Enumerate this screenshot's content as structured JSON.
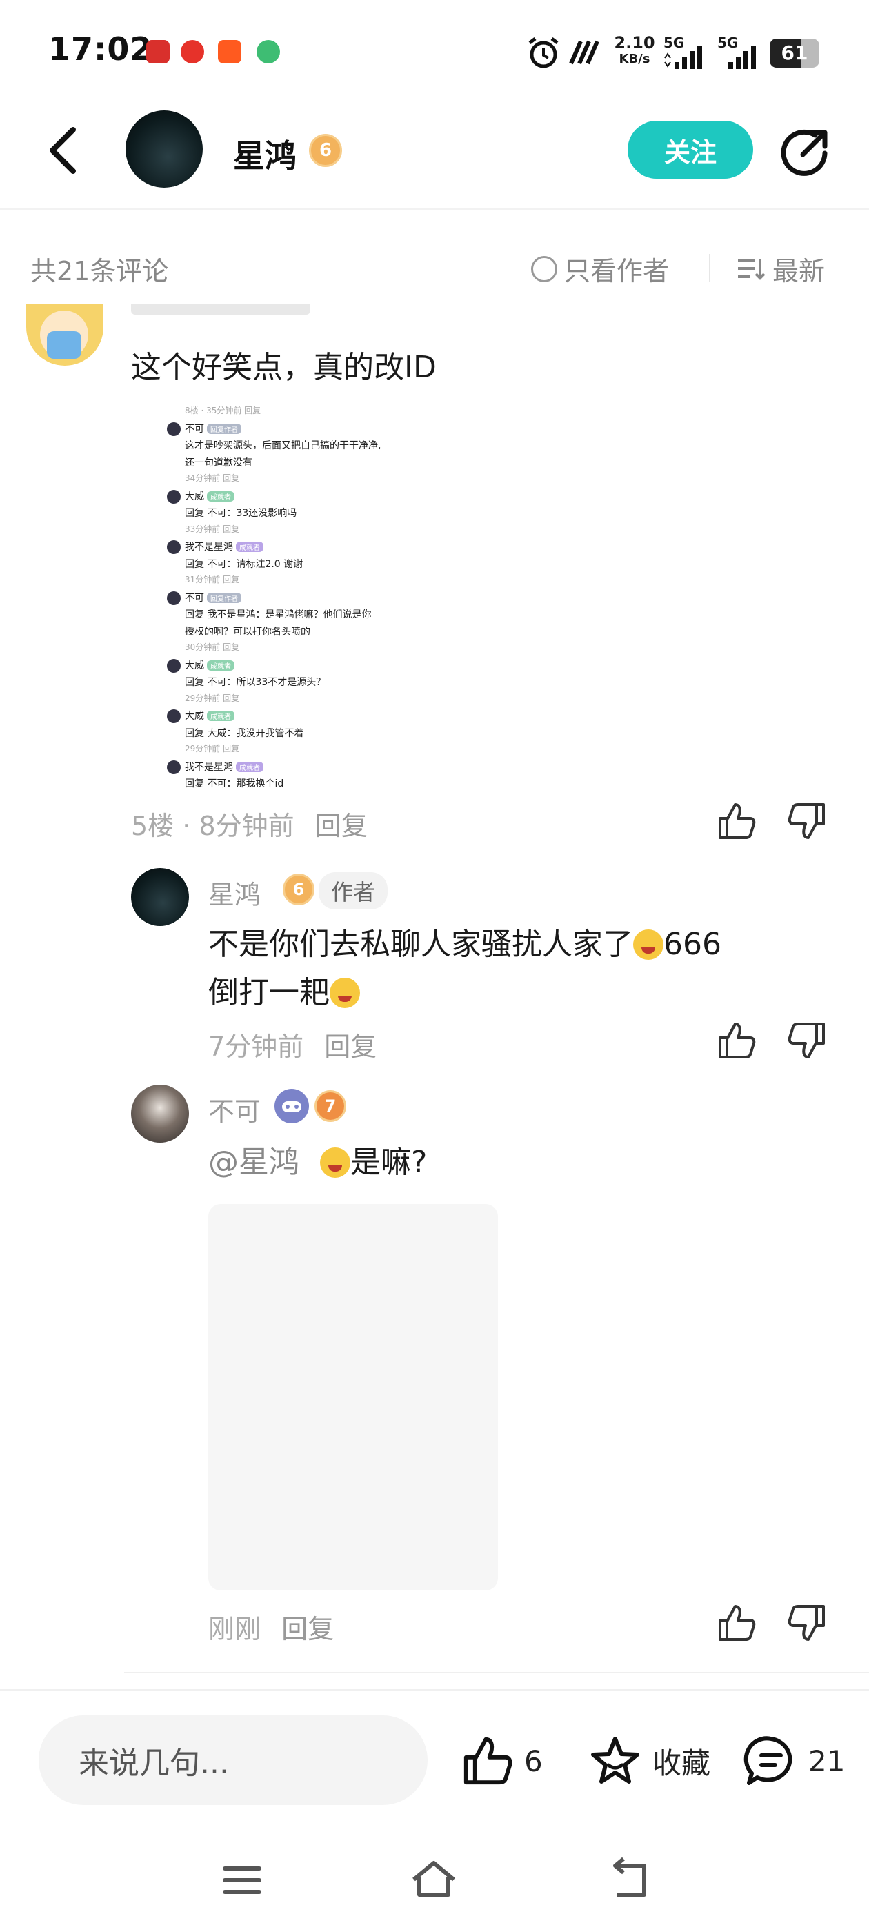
{
  "status": {
    "time": "17:02",
    "net_speed_value": "2.10",
    "net_speed_unit": "KB/s",
    "sim1": "5G",
    "sim2": "5G",
    "battery": "61"
  },
  "header": {
    "user_name": "星鸿",
    "level": "6",
    "follow_label": "关注"
  },
  "sort_bar": {
    "count_label": "共21条评论",
    "only_author_label": "只看作者",
    "newest_label": "最新"
  },
  "comments": [
    {
      "text": "这个好笑点，真的改ID",
      "floor": "5楼",
      "time": "8分钟前",
      "reply_label": "回复",
      "image": {
        "rows": [
          {
            "t": "8楼 · 35分钟前  回复",
            "g": true
          },
          {
            "t": "不可",
            "tag": "回复作者"
          },
          {
            "t": "这才是吵架源头，后面又把自己搞的干干净净,"
          },
          {
            "t": "还一句道歉没有"
          },
          {
            "t": "34分钟前  回复",
            "g": true
          },
          {
            "t": "大威",
            "tag": "成就者"
          },
          {
            "t": "回复 不可：33还没影响吗"
          },
          {
            "t": "33分钟前  回复",
            "g": true
          },
          {
            "t": "我不是星鸿",
            "tag": "成就者"
          },
          {
            "t": "回复 不可：请标注2.0 谢谢"
          },
          {
            "t": "31分钟前  回复",
            "g": true
          },
          {
            "t": "不可",
            "tag": "回复作者"
          },
          {
            "t": "回复 我不是星鸿：是星鸿佬嘛？他们说是你"
          },
          {
            "t": "授权的啊？可以打你名头喷的"
          },
          {
            "t": "30分钟前  回复",
            "g": true
          },
          {
            "t": "大威",
            "tag": "成就者"
          },
          {
            "t": "回复 不可：所以33不才是源头？"
          },
          {
            "t": "29分钟前  回复",
            "g": true
          },
          {
            "t": "大威",
            "tag": "成就者"
          },
          {
            "t": "回复 大威：我没开我管不着"
          },
          {
            "t": "29分钟前  回复",
            "g": true
          },
          {
            "t": "我不是星鸿",
            "tag": "成就者"
          },
          {
            "t": "回复 不可：那我换个id"
          }
        ]
      }
    },
    {
      "user_name": "星鸿",
      "level": "6",
      "author_tag": "作者",
      "text_line1": "不是你们去私聊人家骚扰人家了",
      "text_line1_suffix": "666",
      "text_line2": "倒打一耙",
      "time": "7分钟前",
      "reply_label": "回复"
    },
    {
      "user_name": "不可",
      "level": "7",
      "mention": "@星鸿",
      "text": "是嘛?",
      "time": "刚刚",
      "reply_label": "回复"
    }
  ],
  "bottom_bar": {
    "input_placeholder": "来说几句...",
    "like_count": "6",
    "favorite_label": "收藏",
    "comment_count": "21"
  },
  "colors": {
    "accent": "#1ec8c0",
    "badge": "#f3b35c",
    "muted": "#999999"
  },
  "icons": [
    "back-arrow-icon",
    "share-icon",
    "thumb-up-icon",
    "thumb-down-icon",
    "star-icon",
    "comment-icon",
    "menu-icon",
    "home-icon",
    "back-nav-icon"
  ]
}
